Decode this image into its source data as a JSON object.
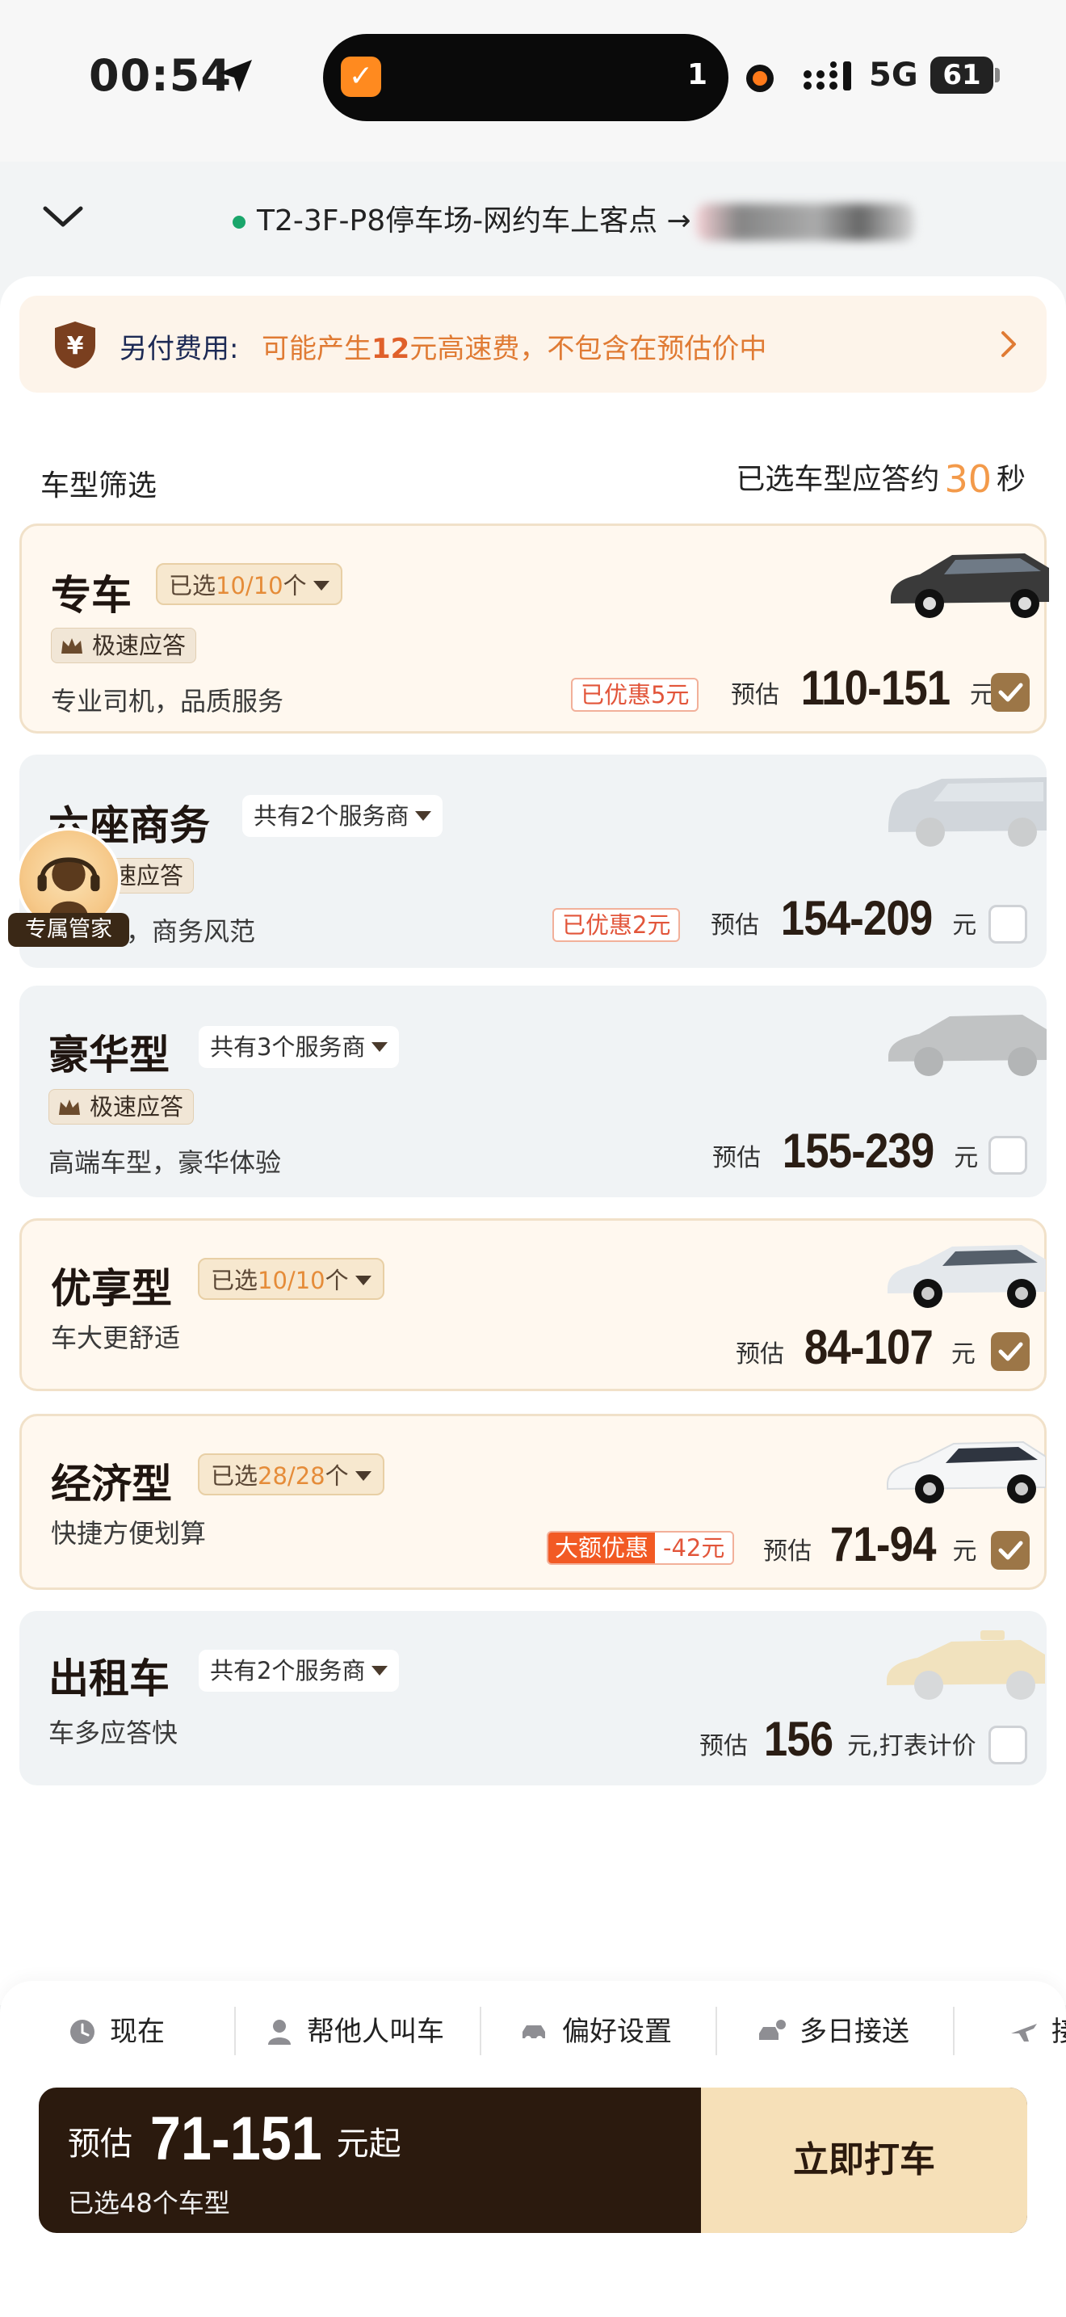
{
  "status_bar": {
    "time": "00:54",
    "island_count": "1",
    "network": "5G",
    "battery": "61"
  },
  "header": {
    "route": "T2-3F-P8停车场-网约车上客点 →"
  },
  "notice": {
    "label": "另付费用:",
    "msg_pre": "可能产生",
    "amount": "12",
    "msg_post": "元高速费，不包含在预估价中"
  },
  "filter": {
    "title": "车型筛选",
    "resp_pre": "已选车型应答约",
    "resp_sec": "30",
    "resp_post": "秒"
  },
  "cars": [
    {
      "name": "专车",
      "pill_pre": "已选",
      "pill_count": "10/10",
      "pill_post": "个",
      "badge": "极速应答",
      "desc": "专业司机，品质服务",
      "discount": "已优惠5元",
      "price_pre": "预估",
      "price": "110-151",
      "unit": "元",
      "checked": true
    },
    {
      "name": "六座商务",
      "pill": "共有2个服务商",
      "badge": "极速应答",
      "desc": "大空间，商务风范",
      "discount": "已优惠2元",
      "price_pre": "预估",
      "price": "154-209",
      "unit": "元",
      "checked": false
    },
    {
      "name": "豪华型",
      "pill": "共有3个服务商",
      "badge": "极速应答",
      "desc": "高端车型，豪华体验",
      "price_pre": "预估",
      "price": "155-239",
      "unit": "元",
      "checked": false
    },
    {
      "name": "优享型",
      "pill_pre": "已选",
      "pill_count": "10/10",
      "pill_post": "个",
      "desc": "车大更舒适",
      "price_pre": "预估",
      "price": "84-107",
      "unit": "元",
      "checked": true
    },
    {
      "name": "经济型",
      "pill_pre": "已选",
      "pill_count": "28/28",
      "pill_post": "个",
      "desc": "快捷方便划算",
      "big_discount_label": "大额优惠",
      "big_discount_value": "-42元",
      "price_pre": "预估",
      "price": "71-94",
      "unit": "元",
      "checked": true
    },
    {
      "name": "出租车",
      "pill": "共有2个服务商",
      "desc": "车多应答快",
      "price_pre": "预估",
      "price": "156",
      "unit": "元,打表计价",
      "checked": false
    }
  ],
  "agent": {
    "label": "专属管家"
  },
  "options": [
    "现在",
    "帮他人叫车",
    "偏好设置",
    "多日接送",
    "接"
  ],
  "cta": {
    "price_pre": "预估",
    "price": "71-151",
    "price_post": "元起",
    "sub": "已选48个车型",
    "button": "立即打车"
  },
  "icons": [
    "location-arrow-icon",
    "check-app-icon",
    "signal-icon",
    "chevron-down-icon",
    "yuan-shield-icon",
    "chevron-right-icon",
    "crown-icon",
    "checkbox-icon",
    "car-icon",
    "headset-agent-icon",
    "clock-icon",
    "person-icon",
    "car-settings-icon",
    "multi-day-icon",
    "plane-icon"
  ],
  "colors": {
    "accent_orange": "#e07b34",
    "brand_brown": "#2b1a0e",
    "check_brown": "#9c7647",
    "cta_gold": "#f6e0b8",
    "discount_red": "#f25a24"
  }
}
